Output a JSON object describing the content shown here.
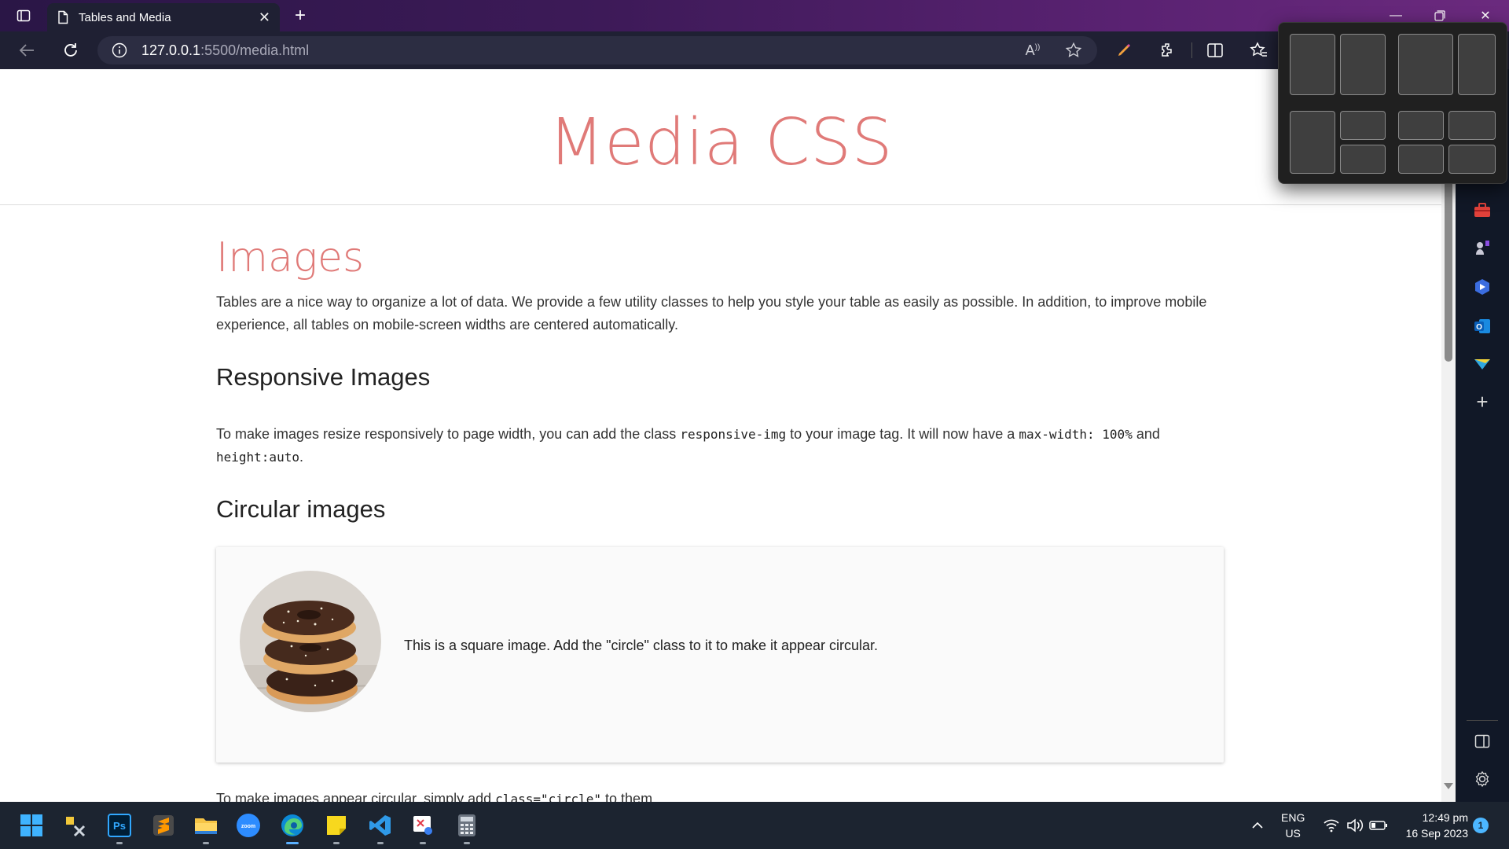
{
  "browser": {
    "tab_title": "Tables and Media",
    "url_host": "127.0.0.1",
    "url_rest": ":5500/media.html"
  },
  "page": {
    "hero_title": "Media CSS",
    "section_title": "Images",
    "intro": "Tables are a nice way to organize a lot of data. We provide a few utility classes to help you style your table as easily as possible. In addition, to improve mobile experience, all tables on mobile-screen widths are centered automatically.",
    "responsive": {
      "heading": "Responsive Images",
      "text_1": "To make images resize responsively to page width, you can add the class ",
      "code_1": "responsive-img",
      "text_2": " to your image tag. It will now have a ",
      "code_2": "max-width: 100%",
      "text_3": " and ",
      "code_3": "height:auto",
      "text_4": "."
    },
    "circular": {
      "heading": "Circular images",
      "caption": "This is a square image. Add the \"circle\" class to it to make it appear circular.",
      "cut_text": "To make images appear circular, simply add ",
      "cut_code": "class=\"circle\"",
      "cut_end": " to them."
    }
  },
  "taskbar": {
    "lang_1": "ENG",
    "lang_2": "US",
    "time": "12:49 pm",
    "date": "16 Sep 2023",
    "notifications": "1"
  },
  "colors": {
    "accent_heading": "#e07a78",
    "titlebar_start": "#2a1646",
    "titlebar_end": "#6b2a7e"
  },
  "icons": [
    "tab-actions-icon",
    "page-icon",
    "close-icon",
    "new-tab-icon",
    "minimize-icon",
    "restore-icon",
    "close-window-icon",
    "back-icon",
    "refresh-icon",
    "info-icon",
    "read-aloud-icon",
    "favorite-star-icon",
    "pen-icon",
    "extensions-icon",
    "split-screen-icon",
    "favorites-icon",
    "toolbox-icon",
    "games-icon",
    "copilot-icon",
    "outlook-icon",
    "drop-icon",
    "add-icon",
    "sidebar-toggle-icon",
    "settings-icon",
    "windows-start-icon",
    "chevron-up-icon",
    "wifi-icon",
    "volume-icon",
    "battery-icon"
  ]
}
